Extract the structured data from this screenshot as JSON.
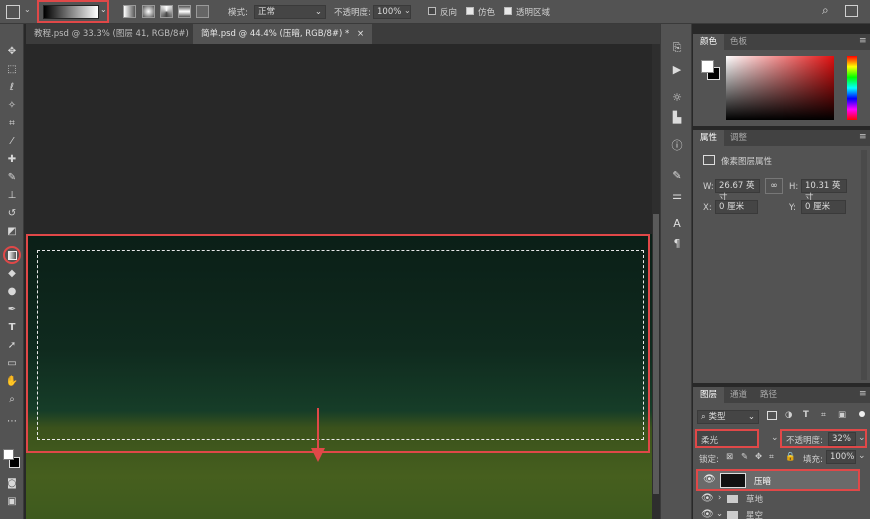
{
  "options": {
    "mode_label": "模式:",
    "mode_value": "正常",
    "opacity_label": "不透明度:",
    "opacity_value": "100%",
    "reverse_label": "反向",
    "dither_label": "仿色",
    "transparency_label": "透明区域"
  },
  "tabs": [
    {
      "label": "教程.psd @ 33.3% (图层 41, RGB/8#)"
    },
    {
      "label": "简单.psd @ 44.4% (压暗, RGB/8#) *"
    }
  ],
  "color_panel": {
    "tab_color": "颜色",
    "tab_swatches": "色板"
  },
  "properties": {
    "tab_props": "属性",
    "tab_adjust": "调整",
    "title": "像素图层属性",
    "w_label": "W:",
    "w_value": "26.67 英寸",
    "h_label": "H:",
    "h_value": "10.31 英寸",
    "x_label": "X:",
    "x_value": "0 厘米",
    "y_label": "Y:",
    "y_value": "0 厘米"
  },
  "layers": {
    "tab_layers": "图层",
    "tab_channels": "通道",
    "tab_paths": "路径",
    "filter_kind": "类型",
    "blend_mode": "柔光",
    "opacity_label": "不透明度:",
    "opacity_value": "32%",
    "lock_label": "锁定:",
    "fill_label": "填充:",
    "fill_value": "100%",
    "items": [
      {
        "name": "压暗"
      },
      {
        "name": "草地"
      },
      {
        "name": "星空"
      }
    ]
  },
  "colors": {
    "accent_red": "#e04848",
    "sky_green": "#0e2a1c",
    "grass": "#3e5a1e"
  }
}
